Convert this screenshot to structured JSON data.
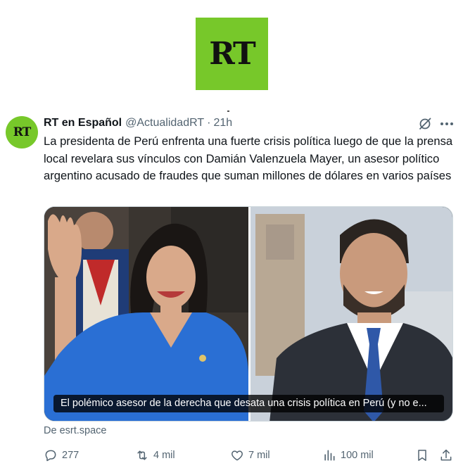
{
  "page": {
    "brand_logo_text": "RT",
    "brand_color": "#77c82a"
  },
  "tweet": {
    "avatar_text": "RT",
    "author_name": "RT en Español",
    "author_handle": "@ActualidadRT",
    "separator": "·",
    "time": "21h",
    "text": "La presidenta de Perú enfrenta una fuerte crisis política luego de que la prensa local revelara sus vínculos con Damián Valenzuela Mayer, un asesor político argentino acusado de fraudes que suman millones de dólares en varios países",
    "media_caption": "El polémico asesor de la derecha que desata una crisis política en Perú (y no e...",
    "source": "De esrt.space",
    "icons": {
      "grok": "grok-icon",
      "more": "more-icon"
    }
  },
  "actions": {
    "reply": {
      "icon": "reply-icon",
      "count": "277"
    },
    "retweet": {
      "icon": "retweet-icon",
      "count": "4 mil"
    },
    "like": {
      "icon": "heart-icon",
      "count": "7 mil"
    },
    "views": {
      "icon": "views-icon",
      "count": "100 mil"
    },
    "bookmark": {
      "icon": "bookmark-icon"
    },
    "share": {
      "icon": "share-icon"
    }
  },
  "colors": {
    "text": "#0f1419",
    "secondary": "#536471",
    "border": "#cfd9de"
  }
}
